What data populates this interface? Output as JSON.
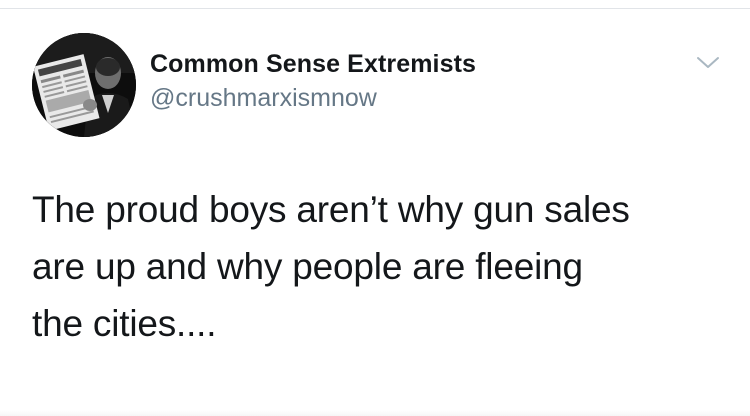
{
  "tweet": {
    "author": {
      "display_name": "Common Sense Extremists",
      "handle": "@crushmarxismnow",
      "avatar_icon": "profile-photo"
    },
    "menu_icon": "chevron-down-icon",
    "text": "The proud boys aren’t why gun sales\nare up and why people are fleeing\nthe cities...."
  },
  "colors": {
    "primary_text": "#14171a",
    "secondary_text": "#657786",
    "divider": "#e1e4e8",
    "background": "#ffffff"
  }
}
